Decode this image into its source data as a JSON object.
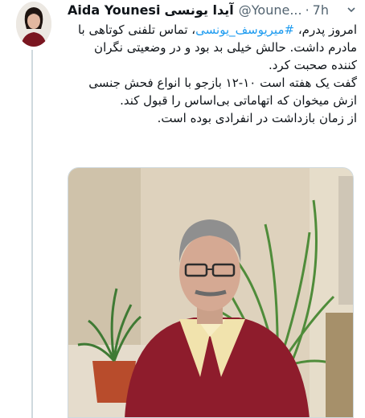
{
  "tweet": {
    "author": {
      "display_name": "Aida Younesi",
      "display_name_fa": "آیدا یونسی",
      "handle": "@Youne...",
      "avatar_icon": "avatar-photo"
    },
    "separator": "·",
    "time": "7h",
    "more_icon": "chevron-down-icon",
    "text": {
      "line1_prefix": "امروز پدرم، ",
      "hashtag": "#میریوسف_یونسی",
      "line1_suffix": "، تماس تلفنی کوتاهی با مادرم داشت. حالش خیلی بد بود و در وضعیتی نگران کننده صحبت کرد.",
      "paragraph2": "گفت یک هفته است ۱۰-۱۲ بازجو با انواع فحش جنسی ازش میخوان که اتهاماتی بی‌اساس را قبول کند.",
      "paragraph3": "از زمان بازداشت در انفرادی بوده است."
    },
    "media": {
      "icon": "photo-elderly-man-with-plants"
    }
  },
  "colors": {
    "link": "#1d9bf0",
    "secondary_text": "#536471",
    "thread_line": "#cfd9de"
  }
}
